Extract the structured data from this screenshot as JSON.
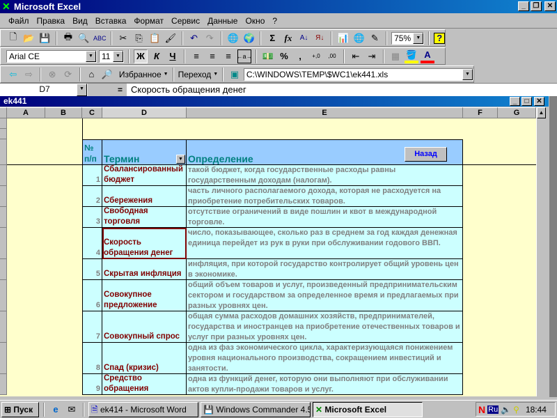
{
  "app": {
    "title": "Microsoft Excel"
  },
  "menu": [
    "Файл",
    "Правка",
    "Вид",
    "Вставка",
    "Формат",
    "Сервис",
    "Данные",
    "Окно",
    "?"
  ],
  "toolbar": {
    "zoom": "75%",
    "font": "Arial CE",
    "size": "11",
    "bold": "Ж",
    "italic": "К",
    "underline": "Ч",
    "percent": "%",
    "comma": ",",
    "favorites": "Избранное",
    "go": "Переход",
    "address": "C:\\WINDOWS\\TEMP\\$WC1\\ek441.xls",
    "sigma": "Σ",
    "fx": "fx"
  },
  "formula_bar": {
    "cell_ref": "D7",
    "equals": "=",
    "value": "Скорость обращения денег"
  },
  "workbook": {
    "title": "ek441"
  },
  "columns": [
    "A",
    "B",
    "C",
    "D",
    "E",
    "F",
    "G"
  ],
  "table": {
    "headers": {
      "num": "№ п/п",
      "term": "Термин",
      "definition": "Определение"
    },
    "back_button": "Назад",
    "rows": [
      {
        "n": "1",
        "term": "Сбалансированный бюджет",
        "def": "такой бюджет, когда государственные расходы равны государственным доходам (налогам)."
      },
      {
        "n": "2",
        "term": "Сбережения",
        "def": " часть личного располагаемого дохода, которая не расходуется на приобретение потребительских товаров."
      },
      {
        "n": "3",
        "term": "Свободная торговля",
        "def": "отсутствие ограничений в виде пошлин и квот в международной торговле."
      },
      {
        "n": "4",
        "term": "Скорость обращения денег",
        "def": "число, показывающее, сколько раз в среднем за год каждая денежная единица перейдет из рук в руки при обслуживании годового ВВП."
      },
      {
        "n": "5",
        "term": "Скрытая инфляция",
        "def": "инфляция, при которой государство контролирует общий уровень цен в экономике."
      },
      {
        "n": "6",
        "term": "Совокупное предложение",
        "def": " общий объем товаров и услуг, произведенный предпринимательским сектором и государством за определенное время и предлагаемых при разных уровнях цен."
      },
      {
        "n": "7",
        "term": "Совокупный спрос",
        "def": "общая сумма расходов домашних хозяйств, предпринимателей, государства и иностранцев на приобретение отечественных товаров и услуг при разных уровнях цен."
      },
      {
        "n": "8",
        "term": "Спад (кризис)",
        "def": "одна из фаз экономического цикла, характеризующаяся понижением уровня национального производства, сокращением инвестиций и занятости."
      },
      {
        "n": "9",
        "term": "Средство обращения",
        "def": "одна из функций денег, которую они выполняют при обслуживании актов купли-продажи товаров и услуг."
      }
    ]
  },
  "taskbar": {
    "start": "Пуск",
    "items": [
      "ek414 - Microsoft Word",
      "Windows Commander 4.51...",
      "Microsoft Excel"
    ],
    "lang": "Ru",
    "clock": "18:44"
  }
}
